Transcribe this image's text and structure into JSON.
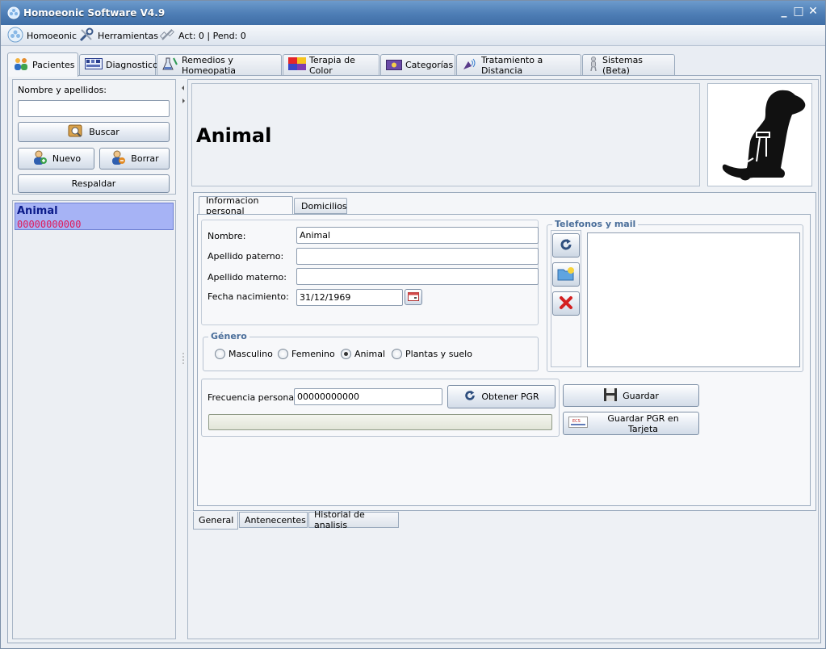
{
  "window": {
    "title": "Homoeonic Software V4.9",
    "controls": [
      "minimize",
      "maximize",
      "close"
    ]
  },
  "toolbar": {
    "home_label": "Homoeonic",
    "tools_label": "Herramientas",
    "status_label": "Act: 0 | Pend: 0"
  },
  "main_tabs": [
    {
      "label": "Pacientes",
      "icon": "patients-icon",
      "active": true
    },
    {
      "label": "Diagnostico",
      "icon": "diagnostic-icon"
    },
    {
      "label": "Remedios y Homeopatia",
      "icon": "flask-icon"
    },
    {
      "label": "Terapia de Color",
      "icon": "color-palette-icon"
    },
    {
      "label": "Categorías",
      "icon": "categories-icon"
    },
    {
      "label": "Tratamiento a Distancia",
      "icon": "remote-treatment-icon"
    },
    {
      "label": "Sistemas (Beta)",
      "icon": "human-body-icon"
    }
  ],
  "search": {
    "label": "Nombre y apellidos:",
    "value": "",
    "search_button": "Buscar",
    "new_button": "Nuevo",
    "delete_button": "Borrar",
    "backup_button": "Respaldar"
  },
  "patient_list": [
    {
      "name": "Animal",
      "code": "00000000000",
      "selected": true
    }
  ],
  "header": {
    "patient_name": "Animal",
    "photo": "dog-silhouette-image"
  },
  "sub_tabs": [
    {
      "label": "Informacion personal",
      "active": true
    },
    {
      "label": "Domicilios"
    }
  ],
  "personal": {
    "nombre_label": "Nombre:",
    "nombre_value": "Animal",
    "paterno_label": "Apellido paterno:",
    "paterno_value": "",
    "materno_label": "Apellido materno:",
    "materno_value": "",
    "fecha_label": "Fecha nacimiento:",
    "fecha_value": "31/12/1969"
  },
  "gender": {
    "title": "Género",
    "options": [
      "Masculino",
      "Femenino",
      "Animal",
      "Plantas y suelo"
    ],
    "selected": "Animal"
  },
  "contacts": {
    "title": "Telefonos y mail"
  },
  "frequency": {
    "label": "Frecuencia personal:",
    "value": "00000000000",
    "obtain_button": "Obtener PGR",
    "progress": 0
  },
  "actions": {
    "save_button": "Guardar",
    "save_card_button": "Guardar PGR en Tarjeta"
  },
  "bottom_tabs": [
    {
      "label": "General",
      "active": true
    },
    {
      "label": "Antenecentes"
    },
    {
      "label": "Historial de analisis"
    }
  ],
  "colors": {
    "title_bar": "#4d7db5",
    "selected_row": "#a6b3f5",
    "code_text": "#e0195a",
    "group_title": "#4a6e9a"
  }
}
